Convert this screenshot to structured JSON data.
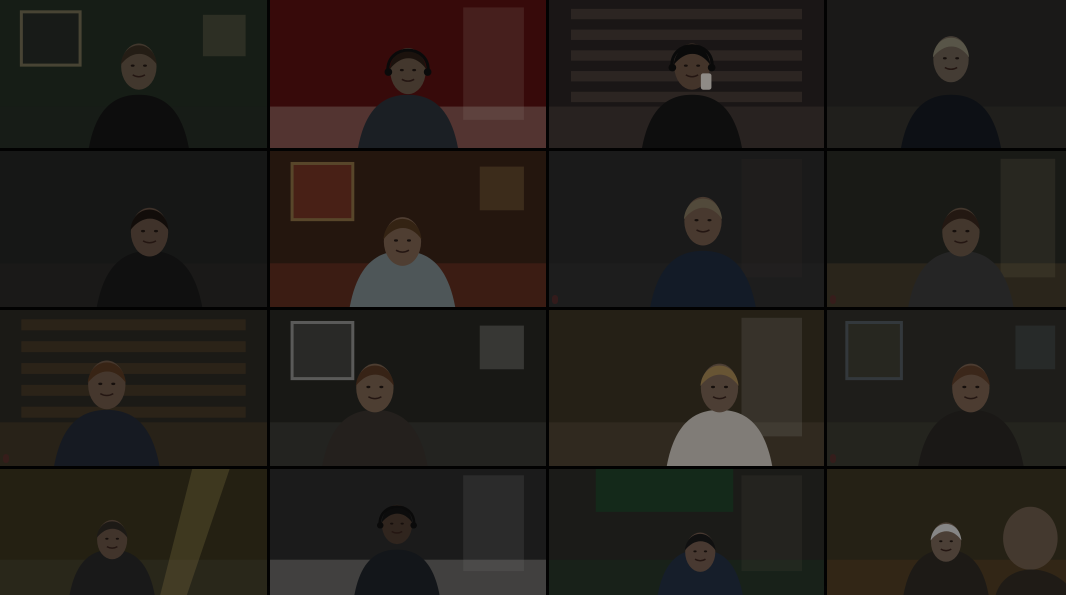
{
  "window": {
    "title": ""
  },
  "participants": [
    {
      "name": "",
      "scene": {
        "wall": "#243024",
        "shirt": "#151515",
        "skin": "#6a5a4a",
        "hair": "#3b3022",
        "prop": "#2a2a2a",
        "accent": "#b7a37c"
      },
      "icon": "person-video-icon"
    },
    {
      "name": "",
      "scene": {
        "wall": "#5a1111",
        "shirt": "#2d333b",
        "skin": "#6d5a4a",
        "hair": "#2d1e15",
        "prop": "#d9d2c7",
        "accent": "#fff3e0"
      },
      "icon": "person-video-icon"
    },
    {
      "name": "",
      "scene": {
        "wall": "#2b2424",
        "shirt": "#171717",
        "skin": "#6d5444",
        "hair": "#111111",
        "prop": "#6b5d53",
        "accent": "#e7e0d8"
      },
      "icon": "person-video-icon"
    },
    {
      "name": "",
      "scene": {
        "wall": "#2a2927",
        "shirt": "#151b22",
        "skin": "#6e6255",
        "hair": "#8f8a74",
        "prop": "#48443d",
        "accent": "#d4d4d4"
      },
      "icon": "person-video-icon"
    },
    {
      "name": "",
      "scene": {
        "wall": "#252625",
        "shirt": "#1b1b1b",
        "skin": "#665244",
        "hair": "#1d1511",
        "prop": "#35312c",
        "accent": "#e2e2e2"
      },
      "icon": "person-video-icon"
    },
    {
      "name": "",
      "scene": {
        "wall": "#3b2418",
        "shirt": "#7f8b8f",
        "skin": "#806451",
        "hair": "#55391f",
        "prop": "#a3422e",
        "accent": "#d2b26b"
      },
      "icon": "person-video-icon"
    },
    {
      "name": "",
      "scene": {
        "wall": "#2b2b2b",
        "shirt": "#1f2d3f",
        "skin": "#745d4d",
        "hair": "#85785f",
        "prop": "#363636",
        "accent": "#5c4841"
      },
      "icon": "person-video-icon"
    },
    {
      "name": "",
      "scene": {
        "wall": "#292a25",
        "shirt": "#3d3d3d",
        "skin": "#6c5949",
        "hair": "#39271d",
        "prop": "#79613d",
        "accent": "#cfbd8a"
      },
      "icon": "person-video-icon"
    },
    {
      "name": "",
      "scene": {
        "wall": "#2d2b24",
        "shirt": "#252b37",
        "skin": "#705a4a",
        "hair": "#5b3b22",
        "prop": "#674c2f",
        "accent": "#d6b77d"
      },
      "icon": "person-video-icon"
    },
    {
      "name": "",
      "scene": {
        "wall": "#282822",
        "shirt": "#3a3530",
        "skin": "#7c6451",
        "hair": "#5a3925",
        "prop": "#5a5a57",
        "accent": "#eaeaea"
      },
      "icon": "person-video-icon"
    },
    {
      "name": "",
      "scene": {
        "wall": "#3c3424",
        "shirt": "#cfc9c1",
        "skin": "#7b6554",
        "hair": "#a88955",
        "prop": "#6f6250",
        "accent": "#ffffff"
      },
      "icon": "person-video-icon"
    },
    {
      "name": "",
      "scene": {
        "wall": "#31302a",
        "shirt": "#2a2725",
        "skin": "#7b6250",
        "hair": "#60402b",
        "prop": "#4e4c3f",
        "accent": "#6f7f8f"
      },
      "icon": "person-video-icon"
    },
    {
      "name": "",
      "scene": {
        "wall": "#3a351e",
        "shirt": "#292929",
        "skin": "#6a5546",
        "hair": "#2f2a25",
        "prop": "#575244",
        "accent": "#d7c06d"
      },
      "icon": "person-video-icon"
    },
    {
      "name": "",
      "scene": {
        "wall": "#2d2d2d",
        "shirt": "#20252a",
        "skin": "#4e3c31",
        "hair": "#141414",
        "prop": "#dad7d2",
        "accent": "#d9d9d9"
      },
      "icon": "person-video-icon"
    },
    {
      "name": "",
      "scene": {
        "wall": "#2c2c28",
        "shirt": "#253144",
        "skin": "#745d4f",
        "hair": "#1b1b1b",
        "prop": "#1f4a2a",
        "accent": "#92846f"
      },
      "icon": "person-video-icon"
    },
    {
      "name": "",
      "scene": {
        "wall": "#3d3622",
        "shirt": "#2f2b25",
        "skin": "#7a6657",
        "hair": "#d8d8d8",
        "prop": "#794c28",
        "accent": "#ddc088"
      },
      "icon": "person-video-icon"
    }
  ]
}
